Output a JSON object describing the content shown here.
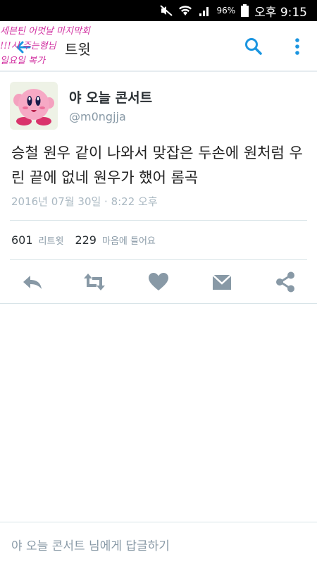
{
  "status_bar": {
    "battery_pct": "96%",
    "clock": "오후 9:15"
  },
  "app_bar": {
    "title": "트윗"
  },
  "scribble": {
    "lines": [
      "세븐틴 어멋날 마지막회",
      "!!!시 주는형님",
      "일요일 복가"
    ]
  },
  "tweet": {
    "display_name": "야 오늘 콘서트",
    "handle": "@m0ngjja",
    "text": "승철 원우 같이 나와서 맞잡은 두손에 원처럼 우린 끝에 없네 원우가 했어 롬곡",
    "timestamp": "2016년 07월 30일 · 8:22 오후",
    "retweet_count": "601",
    "retweet_label": "리트윗",
    "like_count": "229",
    "like_label": "마음에 들어요"
  },
  "reply": {
    "placeholder": "야 오늘 콘서트 님에게 답글하기"
  },
  "colors": {
    "action_gray": "#8899a6",
    "accent_blue": "#1b95e0",
    "scribble_pink": "#d12fa0"
  },
  "icons": {
    "back": "back-arrow-icon",
    "search": "search-icon",
    "menu": "more-vert-icon",
    "reply": "reply-icon",
    "retweet": "retweet-icon",
    "like": "heart-icon",
    "dm": "envelope-icon",
    "share": "share-icon"
  }
}
